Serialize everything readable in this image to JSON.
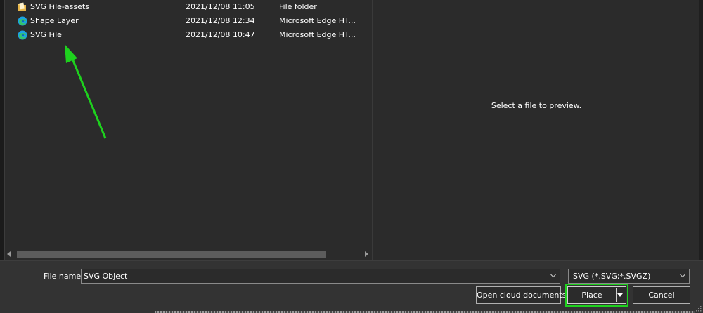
{
  "files": [
    {
      "name": "SVG File-assets",
      "date": "2021/12/08 11:05",
      "type": "File folder",
      "icon": "folder-icon"
    },
    {
      "name": "Shape Layer",
      "date": "2021/12/08 12:34",
      "type": "Microsoft Edge HT...",
      "icon": "edge-icon"
    },
    {
      "name": "SVG File",
      "date": "2021/12/08 10:47",
      "type": "Microsoft Edge HT...",
      "icon": "edge-icon"
    }
  ],
  "preview": {
    "message": "Select a file to preview."
  },
  "footer": {
    "file_name_label": "File name:",
    "file_name_value": "SVG Object",
    "filter_value": "SVG (*.SVG;*.SVGZ)",
    "cloud_label": "Open cloud documents",
    "place_label": "Place",
    "cancel_label": "Cancel"
  },
  "colors": {
    "background": "#2b2b2b",
    "footer": "#333333",
    "annotation": "#1ed11e"
  }
}
